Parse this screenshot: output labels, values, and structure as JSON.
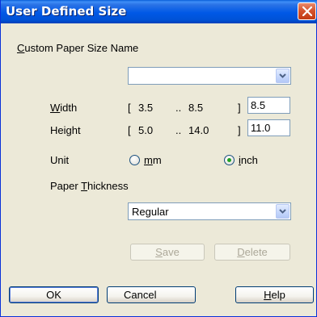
{
  "dialog": {
    "title": "User Defined Size"
  },
  "paper_name": {
    "label_first": "C",
    "label_rest": "ustom Paper Size Name",
    "value": ""
  },
  "width": {
    "label_first": "W",
    "label_rest": "idth",
    "range_open": "[",
    "min": "3.5",
    "range_sep": "..",
    "max": "8.5",
    "range_close": "]",
    "value": "8.5"
  },
  "height": {
    "label": "Height",
    "range_open": "[",
    "min": "5.0",
    "range_sep": "..",
    "max": "14.0",
    "range_close": "]",
    "value": "11.0"
  },
  "unit": {
    "label": "Unit",
    "options": [
      {
        "label_first": "m",
        "label_rest": "m",
        "checked": false
      },
      {
        "label_first": "i",
        "label_rest": "nch",
        "checked": true
      }
    ]
  },
  "thickness": {
    "label_before": "Paper ",
    "label_underlined": "T",
    "label_rest": "hickness",
    "value": "Regular"
  },
  "buttons": {
    "save_first": "S",
    "save_rest": "ave",
    "delete_first": "D",
    "delete_rest": "elete",
    "ok": "OK",
    "cancel": "Cancel",
    "help_first": "H",
    "help_rest": "elp"
  },
  "colors": {
    "titlebar": "#0058e6",
    "dialog_bg": "#ece9d8",
    "close_button": "#d5542e"
  }
}
